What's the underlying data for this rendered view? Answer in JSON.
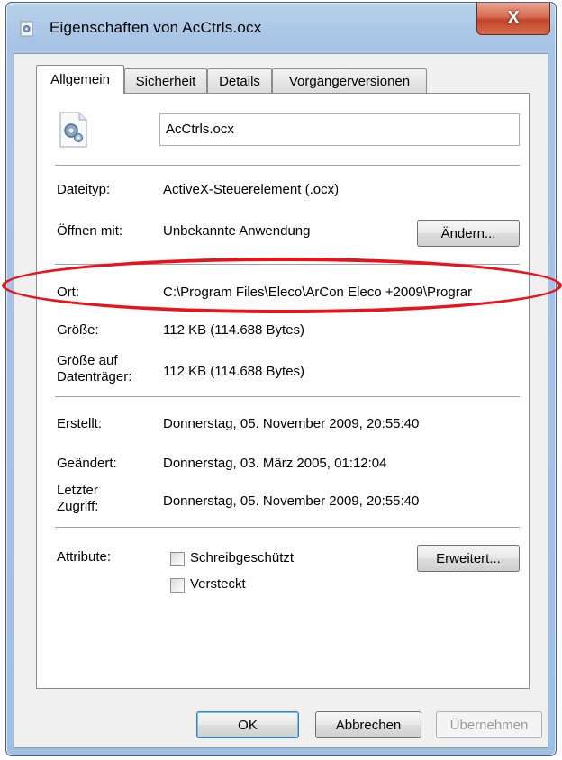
{
  "window": {
    "title": "Eigenschaften von AcCtrls.ocx",
    "close_glyph": "X"
  },
  "tabs": [
    {
      "label": "Allgemein",
      "active": true
    },
    {
      "label": "Sicherheit",
      "active": false
    },
    {
      "label": "Details",
      "active": false
    },
    {
      "label": "Vorgängerversionen",
      "active": false
    }
  ],
  "general": {
    "file_icon": "activex-gear-file-icon",
    "file_name": "AcCtrls.ocx",
    "filetype_label": "Dateityp:",
    "filetype_value": "ActiveX-Steuerelement (.ocx)",
    "openwith_label": "Öffnen mit:",
    "openwith_value": "Unbekannte Anwendung",
    "change_button": "Ändern...",
    "location_label": "Ort:",
    "location_value": "C:\\Program Files\\Eleco\\ArCon Eleco +2009\\Prograr",
    "size_label": "Größe:",
    "size_value": "112 KB (114.688 Bytes)",
    "disksize_label_line1": "Größe auf",
    "disksize_label_line2": "Datenträger:",
    "disksize_value": "112 KB (114.688 Bytes)",
    "created_label": "Erstellt:",
    "created_value": "Donnerstag, 05. November 2009, 20:55:40",
    "modified_label": "Geändert:",
    "modified_value": "Donnerstag, 03. März 2005, 01:12:04",
    "accessed_label_line1": "Letzter",
    "accessed_label_line2": "Zugriff:",
    "accessed_value": "Donnerstag, 05. November 2009, 20:55:40",
    "attributes_label": "Attribute:",
    "readonly_label": "Schreibgeschützt",
    "readonly_checked": false,
    "hidden_label": "Versteckt",
    "hidden_checked": false,
    "advanced_button": "Erweitert..."
  },
  "footer": {
    "ok": "OK",
    "cancel": "Abbrechen",
    "apply": "Übernehmen"
  },
  "colors": {
    "highlight_annotation": "#e8141d",
    "close_button": "#c24529"
  }
}
